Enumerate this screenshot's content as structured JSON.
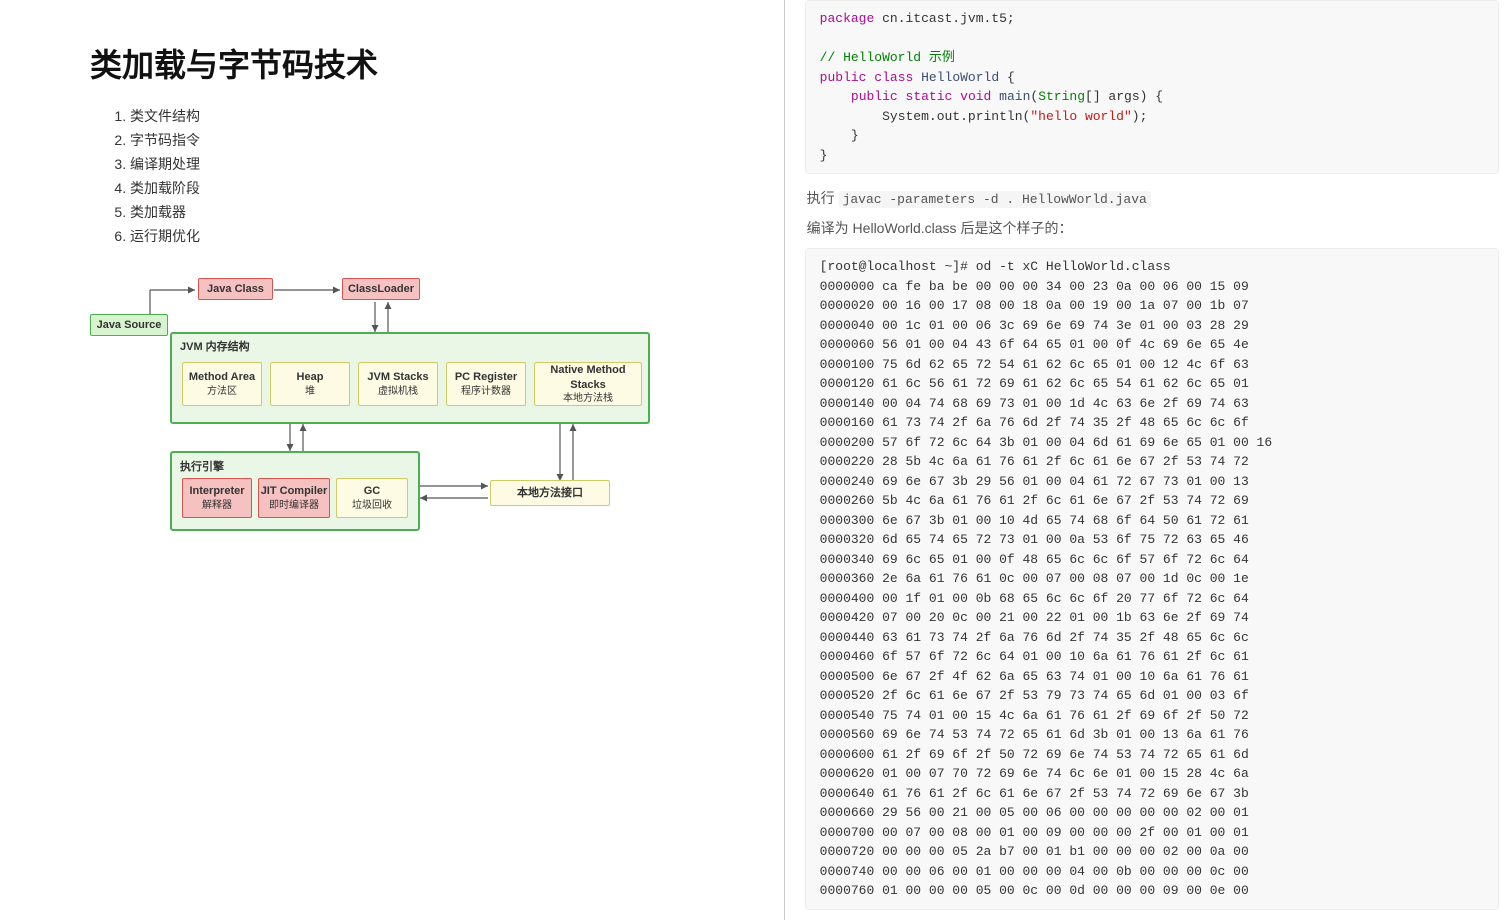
{
  "title": "类加载与字节码技术",
  "toc": [
    "类文件结构",
    "字节码指令",
    "编译期处理",
    "类加载阶段",
    "类加载器",
    "运行期优化"
  ],
  "diagram": {
    "javaSource": "Java Source",
    "javaClass": "Java Class",
    "classLoader": "ClassLoader",
    "jvmStruct": "JVM 内存结构",
    "methodArea": {
      "en": "Method Area",
      "zh": "方法区"
    },
    "heap": {
      "en": "Heap",
      "zh": "堆"
    },
    "jvmStacks": {
      "en": "JVM Stacks",
      "zh": "虚拟机栈"
    },
    "pcRegister": {
      "en": "PC Register",
      "zh": "程序计数器"
    },
    "nativeStacks": {
      "en": "Native Method Stacks",
      "zh": "本地方法栈"
    },
    "execEngine": "执行引擎",
    "interpreter": {
      "en": "Interpreter",
      "zh": "解释器"
    },
    "jit": {
      "en": "JIT Compiler",
      "zh": "即时编译器"
    },
    "gc": {
      "en": "GC",
      "zh": "垃圾回收"
    },
    "nativeInterface": "本地方法接口"
  },
  "right": {
    "execLabel": "执行",
    "javacCmd": "javac -parameters -d . HellowWorld.java",
    "compiledNote": "编译为 HelloWorld.class 后是这个样子的：",
    "odPrompt": "[root@localhost ~]# od -t xC HelloWorld.class"
  },
  "code": {
    "pkg": "package ",
    "pkgName": "cn.itcast.jvm.t5",
    "semi": ";",
    "cmt": "// HelloWorld 示例",
    "pub": "public",
    "cls": "class",
    "clsName": "HelloWorld",
    "lb": "{",
    "rb": "}",
    "indent1": "    ",
    "indent2": "        ",
    "stat": "static",
    "vd": "void",
    "main": "main",
    "lp": "(",
    "rp": ")",
    "strType": "String",
    "arr": "[] args",
    "sout": "System.out.println",
    "hello": "\"hello world\""
  },
  "hexLines": [
    "0000000 ca fe ba be 00 00 00 34 00 23 0a 00 06 00 15 09",
    "0000020 00 16 00 17 08 00 18 0a 00 19 00 1a 07 00 1b 07",
    "0000040 00 1c 01 00 06 3c 69 6e 69 74 3e 01 00 03 28 29",
    "0000060 56 01 00 04 43 6f 64 65 01 00 0f 4c 69 6e 65 4e",
    "0000100 75 6d 62 65 72 54 61 62 6c 65 01 00 12 4c 6f 63",
    "0000120 61 6c 56 61 72 69 61 62 6c 65 54 61 62 6c 65 01",
    "0000140 00 04 74 68 69 73 01 00 1d 4c 63 6e 2f 69 74 63",
    "0000160 61 73 74 2f 6a 76 6d 2f 74 35 2f 48 65 6c 6c 6f",
    "0000200 57 6f 72 6c 64 3b 01 00 04 6d 61 69 6e 65 01 00 16",
    "0000220 28 5b 4c 6a 61 76 61 2f 6c 61 6e 67 2f 53 74 72",
    "0000240 69 6e 67 3b 29 56 01 00 04 61 72 67 73 01 00 13",
    "0000260 5b 4c 6a 61 76 61 2f 6c 61 6e 67 2f 53 74 72 69",
    "0000300 6e 67 3b 01 00 10 4d 65 74 68 6f 64 50 61 72 61",
    "0000320 6d 65 74 65 72 73 01 00 0a 53 6f 75 72 63 65 46",
    "0000340 69 6c 65 01 00 0f 48 65 6c 6c 6f 57 6f 72 6c 64",
    "0000360 2e 6a 61 76 61 0c 00 07 00 08 07 00 1d 0c 00 1e",
    "0000400 00 1f 01 00 0b 68 65 6c 6c 6f 20 77 6f 72 6c 64",
    "0000420 07 00 20 0c 00 21 00 22 01 00 1b 63 6e 2f 69 74",
    "0000440 63 61 73 74 2f 6a 76 6d 2f 74 35 2f 48 65 6c 6c",
    "0000460 6f 57 6f 72 6c 64 01 00 10 6a 61 76 61 2f 6c 61",
    "0000500 6e 67 2f 4f 62 6a 65 63 74 01 00 10 6a 61 76 61",
    "0000520 2f 6c 61 6e 67 2f 53 79 73 74 65 6d 01 00 03 6f",
    "0000540 75 74 01 00 15 4c 6a 61 76 61 2f 69 6f 2f 50 72",
    "0000560 69 6e 74 53 74 72 65 61 6d 3b 01 00 13 6a 61 76",
    "0000600 61 2f 69 6f 2f 50 72 69 6e 74 53 74 72 65 61 6d",
    "0000620 01 00 07 70 72 69 6e 74 6c 6e 01 00 15 28 4c 6a",
    "0000640 61 76 61 2f 6c 61 6e 67 2f 53 74 72 69 6e 67 3b",
    "0000660 29 56 00 21 00 05 00 06 00 00 00 00 00 02 00 01",
    "0000700 00 07 00 08 00 01 00 09 00 00 00 2f 00 01 00 01",
    "0000720 00 00 00 05 2a b7 00 01 b1 00 00 00 02 00 0a 00",
    "0000740 00 00 06 00 01 00 00 00 04 00 0b 00 00 00 0c 00",
    "0000760 01 00 00 00 05 00 0c 00 0d 00 00 00 09 00 0e 00"
  ]
}
